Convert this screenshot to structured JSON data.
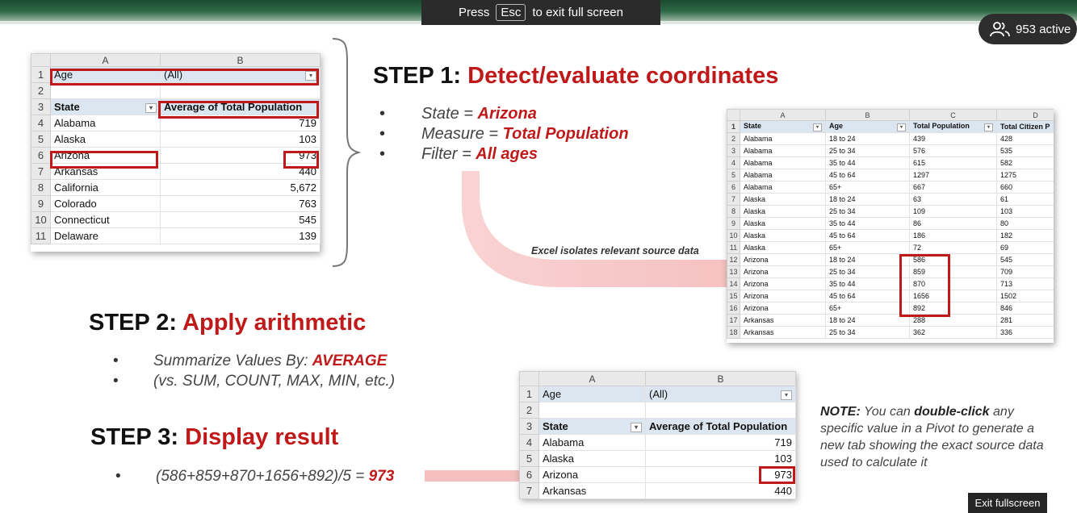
{
  "banner": {
    "press": "Press",
    "key": "Esc",
    "rest": "to exit full screen"
  },
  "active": {
    "label": "953 active"
  },
  "exit_label": "Exit fullscreen",
  "pivot1": {
    "col_a": "A",
    "col_b": "B",
    "filter_label": "Age",
    "filter_value": "(All)",
    "row_field": "State",
    "value_field": "Average of Total Population",
    "rows": [
      {
        "n": "4",
        "state": "Alabama",
        "val": "719"
      },
      {
        "n": "5",
        "state": "Alaska",
        "val": "103"
      },
      {
        "n": "6",
        "state": "Arizona",
        "val": "973"
      },
      {
        "n": "7",
        "state": "Arkansas",
        "val": "440"
      },
      {
        "n": "8",
        "state": "California",
        "val": "5,672"
      },
      {
        "n": "9",
        "state": "Colorado",
        "val": "763"
      },
      {
        "n": "10",
        "state": "Connecticut",
        "val": "545"
      },
      {
        "n": "11",
        "state": "Delaware",
        "val": "139"
      }
    ]
  },
  "step1": {
    "lead": "STEP 1:",
    "title": "Detect/evaluate coordinates",
    "b1_label": "State =",
    "b1_value": "Arizona",
    "b2_label": "Measure =",
    "b2_value": "Total Population",
    "b3_label": "Filter =",
    "b3_value": "All ages"
  },
  "caption": "Excel isolates relevant source data",
  "source": {
    "cols": [
      "A",
      "B",
      "C",
      "D"
    ],
    "headers": [
      "State",
      "Age",
      "Total Population",
      "Total Citizen P"
    ],
    "rows": [
      [
        "2",
        "Alabama",
        "18 to 24",
        "439",
        "428"
      ],
      [
        "3",
        "Alabama",
        "25 to 34",
        "576",
        "535"
      ],
      [
        "4",
        "Alabama",
        "35 to 44",
        "615",
        "582"
      ],
      [
        "5",
        "Alabama",
        "45 to 64",
        "1297",
        "1275"
      ],
      [
        "6",
        "Alabama",
        "65+",
        "667",
        "660"
      ],
      [
        "7",
        "Alaska",
        "18 to 24",
        "63",
        "61"
      ],
      [
        "8",
        "Alaska",
        "25 to 34",
        "109",
        "103"
      ],
      [
        "9",
        "Alaska",
        "35 to 44",
        "86",
        "80"
      ],
      [
        "10",
        "Alaska",
        "45 to 64",
        "186",
        "182"
      ],
      [
        "11",
        "Alaska",
        "65+",
        "72",
        "69"
      ],
      [
        "12",
        "Arizona",
        "18 to 24",
        "586",
        "545"
      ],
      [
        "13",
        "Arizona",
        "25 to 34",
        "859",
        "709"
      ],
      [
        "14",
        "Arizona",
        "35 to 44",
        "870",
        "713"
      ],
      [
        "15",
        "Arizona",
        "45 to 64",
        "1656",
        "1502"
      ],
      [
        "16",
        "Arizona",
        "65+",
        "892",
        "846"
      ],
      [
        "17",
        "Arkansas",
        "18 to 24",
        "288",
        "281"
      ],
      [
        "18",
        "Arkansas",
        "25 to 34",
        "362",
        "336"
      ]
    ]
  },
  "step2": {
    "lead": "STEP 2:",
    "title": "Apply arithmetic",
    "b1_label": "Summarize Values By:",
    "b1_value": "AVERAGE",
    "b2": "(vs. SUM, COUNT, MAX, MIN, etc.)"
  },
  "step3": {
    "lead": "STEP 3:",
    "title": "Display result",
    "formula": "(586+859+870+1656+892)/5 =",
    "result": "973"
  },
  "pivot2": {
    "col_a": "A",
    "col_b": "B",
    "filter_label": "Age",
    "filter_value": "(All)",
    "row_field": "State",
    "value_field": "Average of Total Population",
    "rows": [
      {
        "n": "4",
        "state": "Alabama",
        "val": "719"
      },
      {
        "n": "5",
        "state": "Alaska",
        "val": "103"
      },
      {
        "n": "6",
        "state": "Arizona",
        "val": "973"
      },
      {
        "n": "7",
        "state": "Arkansas",
        "val": "440"
      }
    ]
  },
  "note": {
    "bold1": "NOTE:",
    "t1": "You can",
    "bold2": "double-click",
    "t2": "any specific value in a Pivot to generate a new tab showing the exact source data used to calculate it"
  },
  "colors": {
    "accent_red": "#c0191a",
    "field_blue": "#dce6f1",
    "arrow_pink": "#f4b8b8"
  }
}
